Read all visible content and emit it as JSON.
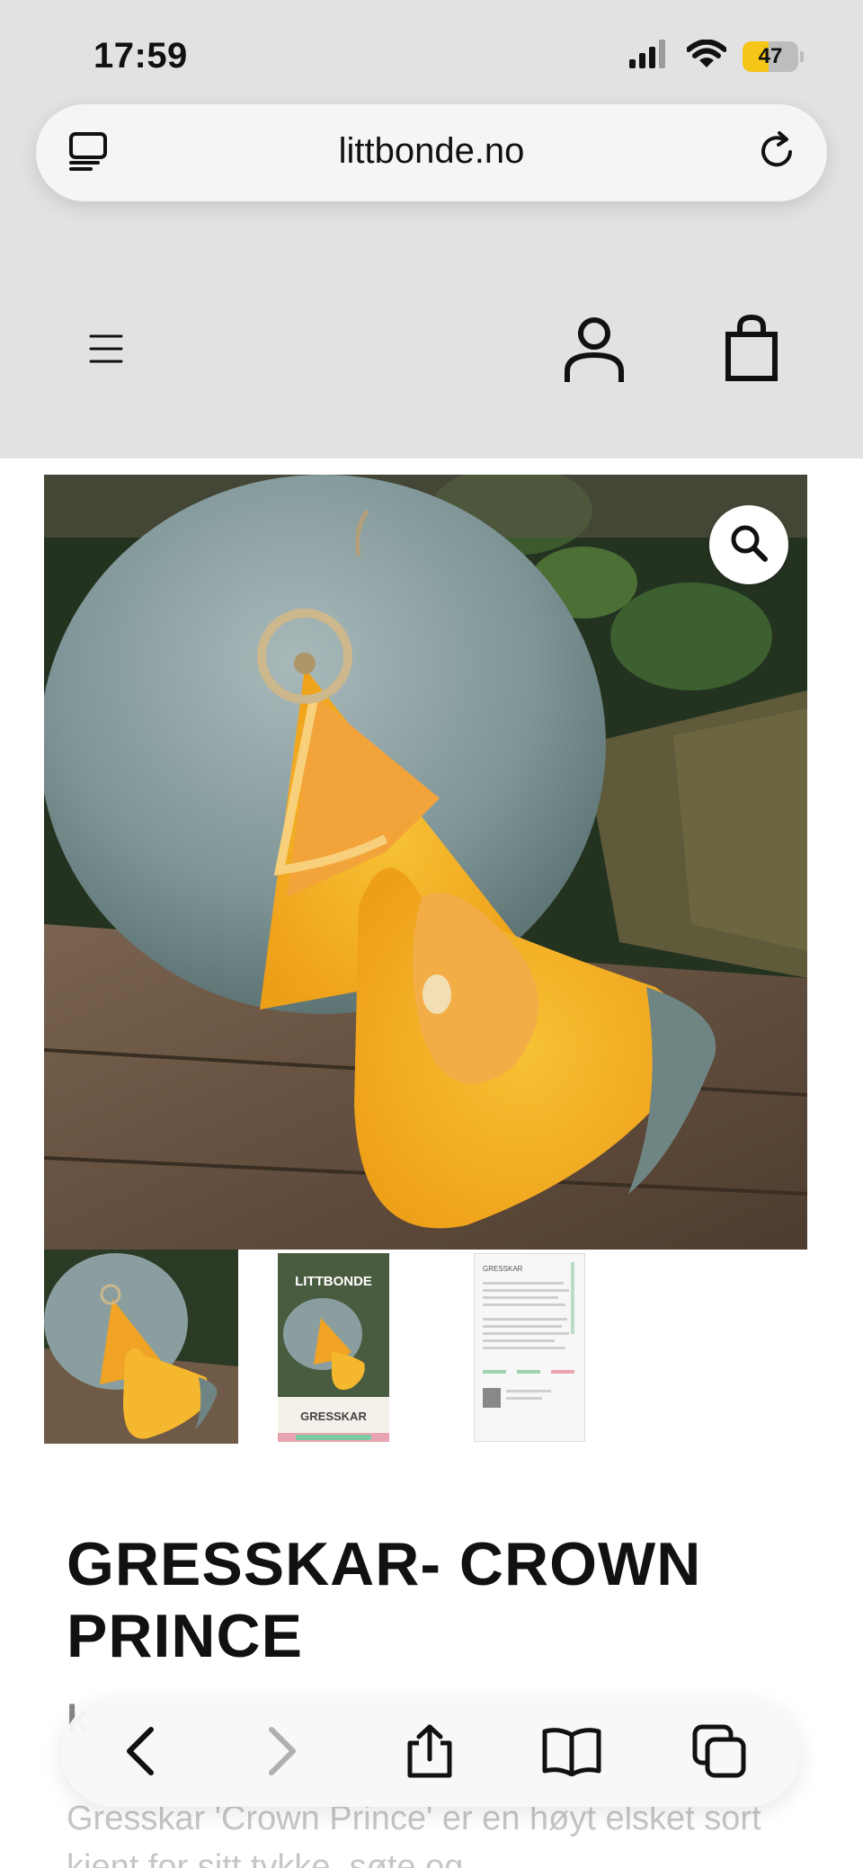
{
  "status_bar": {
    "time": "17:59",
    "battery_level": "47",
    "icons": [
      "cellular-signal-icon",
      "wifi-icon",
      "battery-icon"
    ]
  },
  "browser": {
    "url": "littbonde.no",
    "icons": [
      "tabs-overview-icon",
      "reload-icon"
    ]
  },
  "site_header": {
    "icons": [
      "hamburger-menu-icon",
      "account-icon",
      "shopping-bag-icon"
    ]
  },
  "gallery": {
    "zoom_icon": "magnifier-icon",
    "thumbnails": [
      {
        "kind": "photo"
      },
      {
        "kind": "seed-packet-front",
        "brand": "LITTBONDE",
        "label": "GRESSKAR"
      },
      {
        "kind": "seed-packet-back",
        "label": "GRESSKAR"
      }
    ]
  },
  "product": {
    "title": "GRESSKAR- CROWN PRINCE",
    "price_partial": "k",
    "description_partial": "Gresskar 'Crown Prince' er en høyt elsket sort kjent for sitt tykke, søte og"
  },
  "toolbar": {
    "icons": [
      "back-icon",
      "forward-icon",
      "share-icon",
      "bookmarks-icon",
      "tabs-icon"
    ]
  },
  "colors": {
    "header_background": "#e2e2e2",
    "battery_accent": "#f5c518",
    "text": "#111111"
  }
}
